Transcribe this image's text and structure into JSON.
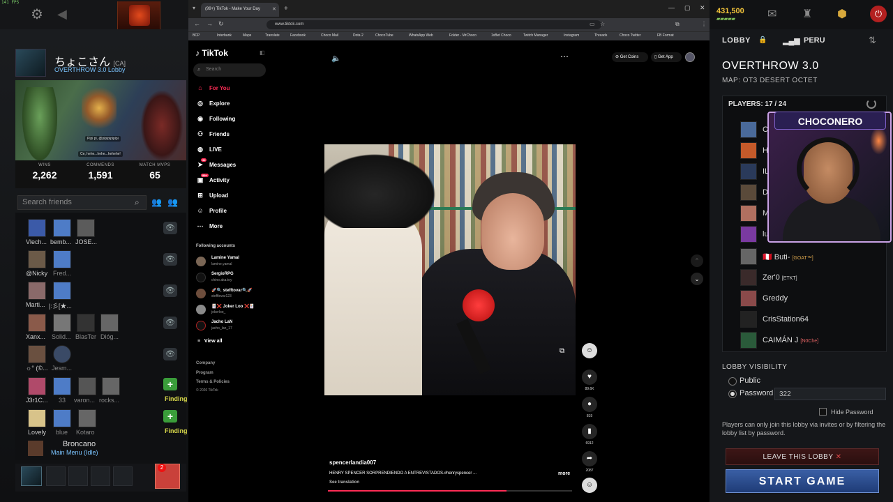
{
  "dota_left": {
    "fps": "141 FPS",
    "profile": {
      "name": "ちょこさん",
      "tag": "[CA]",
      "status": "OVERTHROW 3.0 Lobby"
    },
    "hero_chat": [
      "Pipi pi, @pipipipipipi",
      "Ce, hehe...hehe...hehehe!"
    ],
    "stats": [
      {
        "label": "WINS",
        "value": "2,262"
      },
      {
        "label": "COMMENDS",
        "value": "1,591"
      },
      {
        "label": "MATCH MVPS",
        "value": "65"
      }
    ],
    "search_placeholder": "Search friends",
    "friends": [
      {
        "names": [
          "Vlech...",
          "bemb...",
          "JOSE..."
        ],
        "action": "eye"
      },
      {
        "names": [
          "@Nicky",
          "Fred..."
        ],
        "action": "eye"
      },
      {
        "names": [
          "Marti...",
          "|:彡[★..."
        ],
        "action": "eye"
      },
      {
        "names": [
          "Xanx...",
          "Solid...",
          "BlasTer",
          "Dióg..."
        ],
        "action": "eye"
      },
      {
        "names": [
          "☼° (©...",
          "Jesm..."
        ],
        "action": "eye"
      },
      {
        "names": [
          "J3r1C...",
          "33",
          "varon...",
          "rocks..."
        ],
        "action": "plus",
        "status": "Finding"
      },
      {
        "names": [
          "Lovely",
          "blue",
          "Kotaro"
        ],
        "action": "plus",
        "status": "Finding"
      }
    ],
    "broncano": {
      "name": "Broncano",
      "status": "Main Menu (Idle)"
    },
    "chat_badge": "2"
  },
  "browser": {
    "tab_title": "(99+) TikTok - Make Your Day",
    "url": "www.tiktok.com",
    "bookmarks": [
      "BCP",
      "Interbank",
      "Maps",
      "Translate",
      "Facebook",
      "Choco Mail",
      "Dota 2",
      "ChocoTube",
      "WhatsApp Web",
      "Folder - MrChoco",
      "1xBet Choco",
      "Twitch Manager",
      "Instagram",
      "Threads",
      "Choco Twitter",
      "FB Format"
    ]
  },
  "tiktok": {
    "logo": "TikTok",
    "search_placeholder": "Search",
    "nav": [
      {
        "label": "For You",
        "icon": "home-icon"
      },
      {
        "label": "Explore",
        "icon": "compass-icon"
      },
      {
        "label": "Following",
        "icon": "following-icon"
      },
      {
        "label": "Friends",
        "icon": "friends-icon"
      },
      {
        "label": "LIVE",
        "icon": "live-icon"
      },
      {
        "label": "Messages",
        "icon": "messages-icon",
        "badge": "34"
      },
      {
        "label": "Activity",
        "icon": "activity-icon",
        "badge": "99+"
      },
      {
        "label": "Upload",
        "icon": "upload-icon"
      },
      {
        "label": "Profile",
        "icon": "profile-icon"
      },
      {
        "label": "More",
        "icon": "more-icon"
      }
    ],
    "following_title": "Following accounts",
    "following": [
      {
        "name": "Lamine Yamal",
        "handle": "lamine.yamal"
      },
      {
        "name": "SergioRPG",
        "handle": "chino.aka.toy"
      },
      {
        "name": "🚀🔍 stefftovar🔍🚀",
        "handle": "stefftovar123"
      },
      {
        "name": "🃏❌ Joker Loo ❌🃏",
        "handle": "jokerloo_"
      },
      {
        "name": "Jacho LaN",
        "handle": "jacho_lan_17"
      }
    ],
    "view_all": "View all",
    "footer": [
      "Company",
      "Program",
      "Terms & Policies",
      "© 2026 TikTok"
    ],
    "get_coins": "Get Coins",
    "get_app": "Get App",
    "likes": "89.6K",
    "comments": "819",
    "saves": "6912",
    "shares": "2087",
    "author": "spencerlandia007",
    "description": "HENRY SPENCER SORPRENDIENDO A ENTREVISTADOS.#henryspencer ...",
    "more": "more",
    "see_translation": "See translation",
    "progress": 0.73
  },
  "lobby": {
    "gold": "431,500",
    "lobby_label": "LOBBY",
    "region": "PERU",
    "mode": "OVERTHROW 3.0",
    "map": "MAP: OT3  DESERT  OCTET",
    "players_label": "PLAYERS: 17 / 24",
    "players": [
      {
        "name": "Ch",
        "tag": ""
      },
      {
        "name": "Hl",
        "tag": ""
      },
      {
        "name": "ILT",
        "tag": ""
      },
      {
        "name": "Da",
        "tag": ""
      },
      {
        "name": "Mi",
        "tag": ""
      },
      {
        "name": "lu",
        "tag": ""
      },
      {
        "name": "🇵🇪 Buti-",
        "tag": "[GOAT™]"
      },
      {
        "name": "Zer'0",
        "tag": "[ETKT]"
      },
      {
        "name": "Greddy",
        "tag": ""
      },
      {
        "name": "CrisStation64",
        "tag": ""
      },
      {
        "name": "CAIMÁN J",
        "tag": "[N0Che]"
      }
    ],
    "cam_label": "CHOCONERO",
    "visibility_title": "LOBBY VISIBILITY",
    "public_label": "Public",
    "password_label": "Password",
    "password_value": "322",
    "hide_password": "Hide Password",
    "note": "Players can only join this lobby via invites or by filtering the lobby list by password.",
    "leave_label": "LEAVE THIS LOBBY",
    "start_label": "START GAME"
  }
}
